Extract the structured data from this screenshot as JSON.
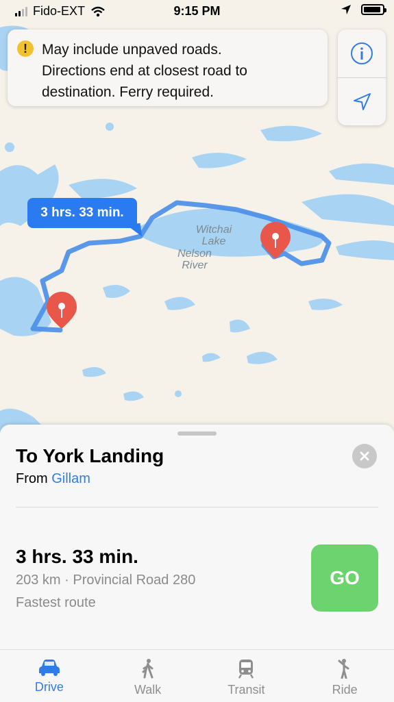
{
  "status_bar": {
    "carrier": "Fido-EXT",
    "time": "9:15 PM"
  },
  "banner": {
    "warning_icon": "!",
    "line1": "May include unpaved roads.",
    "line2": "Directions end at closest road to",
    "line3": "destination. Ferry required."
  },
  "map": {
    "route_callout": "3 hrs. 33 min.",
    "labels": {
      "lake_line1": "Witchai",
      "lake_line2": "Lake",
      "river_line1": "Nelson",
      "river_line2": "River"
    },
    "colors": {
      "route": "#4b8fe8",
      "pin": "#e9574a",
      "water": "#a9d3f2",
      "land": "#f6f2ea"
    }
  },
  "sheet": {
    "title": "To York Landing",
    "from_label": "From",
    "from_place": "Gillam",
    "route_time": "3 hrs. 33 min.",
    "route_detail": "203 km · Provincial Road 280",
    "route_note": "Fastest route",
    "go_label": "GO"
  },
  "tabs": [
    {
      "label": "Drive",
      "icon": "car-icon",
      "active": true
    },
    {
      "label": "Walk",
      "icon": "walk-icon",
      "active": false
    },
    {
      "label": "Transit",
      "icon": "train-icon",
      "active": false
    },
    {
      "label": "Ride",
      "icon": "ride-icon",
      "active": false
    }
  ],
  "colors": {
    "accent": "#2f7ce6",
    "go": "#6dd36f",
    "warning": "#f2c12e"
  }
}
